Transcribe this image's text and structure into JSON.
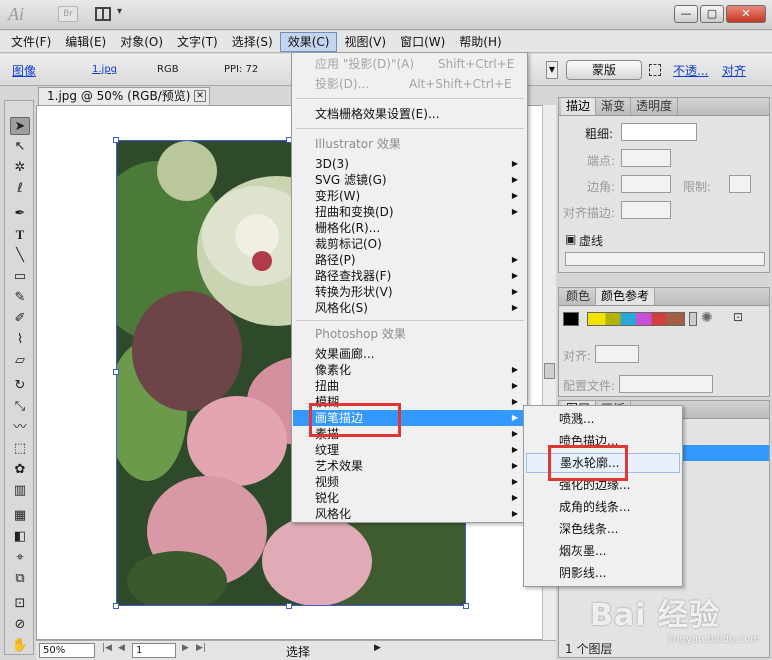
{
  "app": {
    "logo": "Ai",
    "bridge_btn": "Br",
    "arrange_dd": "▾"
  },
  "window_buttons": {
    "minimize": "—",
    "maximize": "▢",
    "close": "✕"
  },
  "menubar": [
    {
      "label": "文件(F)"
    },
    {
      "label": "编辑(E)"
    },
    {
      "label": "对象(O)"
    },
    {
      "label": "文字(T)"
    },
    {
      "label": "选择(S)"
    },
    {
      "label": "效果(C)"
    },
    {
      "label": "视图(V)"
    },
    {
      "label": "窗口(W)"
    },
    {
      "label": "帮助(H)"
    }
  ],
  "controlbar": {
    "image_link": "图像",
    "file_link": "1.jpg",
    "mode": "RGB",
    "ppi": "PPI: 72",
    "mask_btn": "蒙版",
    "opacity_link": "不透...",
    "align_link": "对齐"
  },
  "document": {
    "tab_title": "1.jpg @ 50% (RGB/预览)",
    "close": "✕"
  },
  "statusbar": {
    "zoom": "50%",
    "page": "1",
    "tool_label": "选择"
  },
  "effect_menu": {
    "apply_last": {
      "label": "应用 \"投影(D)\"(A)",
      "shortcut": "Shift+Ctrl+E"
    },
    "last_effect": {
      "label": "投影(D)...",
      "shortcut": "Alt+Shift+Ctrl+E"
    },
    "raster_settings": "文档栅格效果设置(E)...",
    "illustrator_section": "Illustrator 效果",
    "illustrator_items": [
      "3D(3)",
      "SVG 滤镜(G)",
      "变形(W)",
      "扭曲和变换(D)",
      "栅格化(R)...",
      "裁剪标记(O)",
      "路径(P)",
      "路径查找器(F)",
      "转换为形状(V)",
      "风格化(S)"
    ],
    "photoshop_section": "Photoshop 效果",
    "photoshop_items": [
      "效果画廊...",
      "像素化",
      "扭曲",
      "模糊",
      "画笔描边",
      "素描",
      "纹理",
      "艺术效果",
      "视频",
      "锐化",
      "风格化"
    ]
  },
  "submenu_items": [
    "喷溅...",
    "喷色描边...",
    "墨水轮廓...",
    "强化的边缘...",
    "成角的线条...",
    "深色线条...",
    "烟灰墨...",
    "阴影线..."
  ],
  "stroke_panel": {
    "tabs": [
      "描边",
      "渐变",
      "透明度"
    ],
    "weight_label": "粗细:",
    "cap_label": "端点:",
    "corner_label": "边角:",
    "limit_label": "限制:",
    "align_label": "对齐描边:",
    "dashed_label": "虚线"
  },
  "color_panel": {
    "tabs": [
      "颜色",
      "颜色参考"
    ],
    "align_label": "对齐:",
    "profile_label": "配置文件:"
  },
  "layers_panel": {
    "tabs": [
      "图层",
      "画板"
    ],
    "count": "1 个图层"
  },
  "watermark": {
    "logo": "Bai 经验",
    "url": "jingyan.baidu.com"
  },
  "colors": {
    "accent": "#3399ff",
    "highlight_box": "#e23636",
    "link": "#0e3ccf"
  }
}
